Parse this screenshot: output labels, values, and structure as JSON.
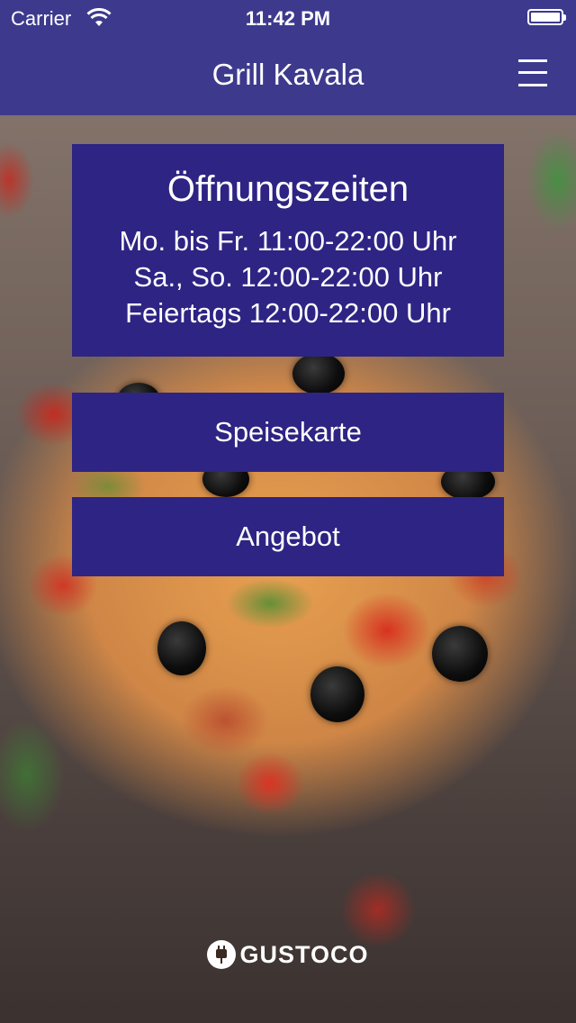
{
  "status_bar": {
    "carrier": "Carrier",
    "time": "11:42 PM",
    "icons": [
      "wifi-icon",
      "battery-icon"
    ]
  },
  "header": {
    "title": "Grill Kavala",
    "menu_icon": "hamburger-menu-icon",
    "background_color": "#3d3a8e"
  },
  "opening_hours": {
    "title": "Öffnungszeiten",
    "lines": [
      "Mo. bis Fr. 11:00-22:00 Uhr",
      "Sa., So. 12:00-22:00 Uhr",
      "Feiertags 12:00-22:00 Uhr"
    ]
  },
  "buttons": {
    "menu_label": "Speisekarte",
    "offer_label": "Angebot",
    "background_color": "#2e2483"
  },
  "footer": {
    "logo_text": "GUSTOCO",
    "logo_icon": "gustoco-plug-icon"
  }
}
